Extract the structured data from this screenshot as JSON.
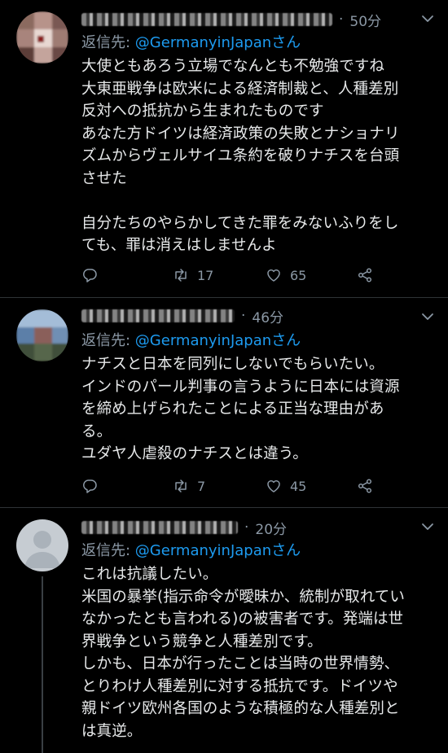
{
  "tweets": [
    {
      "time": "50分",
      "dot": "·",
      "reply_prefix": "返信先: ",
      "reply_handle": "@GermanyinJapan",
      "reply_suffix": "さん",
      "text": "大使ともあろう立場でなんとも不勉強ですね\n大東亜戦争は欧米による経済制裁と、人種差別\n反対への抵抗から生まれたものです\nあなた方ドイツは経済政策の失敗とナショナリ\nズムからヴェルサイユ条約を破りナチスを台頭\nさせた\n\n自分たちのやらかしてきた罪をみないふりをし\nても、罪は消えはしませんよ",
      "retweets": "17",
      "likes": "65"
    },
    {
      "time": "46分",
      "dot": "·",
      "reply_prefix": "返信先: ",
      "reply_handle": "@GermanyinJapan",
      "reply_suffix": "さん",
      "text": "ナチスと日本を同列にしないでもらいたい。\nインドのパール判事の言うように日本には資源\nを締め上げられたことによる正当な理由があ\nる。\nユダヤ人虐殺のナチスとは違う。",
      "retweets": "7",
      "likes": "45"
    },
    {
      "time": "20分",
      "dot": "·",
      "reply_prefix": "返信先: ",
      "reply_handle": "@GermanyinJapan",
      "reply_suffix": "さん",
      "text": "これは抗議したい。\n米国の暴挙(指示命令が曖昧か、統制が取れてい\nなかったとも言われる)の被害者です。発端は世\n界戦争という競争と人種差別です。\nしかも、日本が行ったことは当時の世界情勢、\nとりわけ人種差別に対する抵抗です。ドイツや\n親ドイツ欧州各国のような積極的な人種差別と\nは真逆。"
    }
  ],
  "colors": {
    "background": "#000000",
    "text": "#e7e9ea",
    "muted": "#8b98a5",
    "link": "#1d9bf0",
    "divider": "#2f3336"
  },
  "icons": {
    "reply": "reply-icon",
    "retweet": "retweet-icon",
    "like": "heart-icon",
    "share": "share-icon",
    "more": "chevron-down-icon"
  }
}
